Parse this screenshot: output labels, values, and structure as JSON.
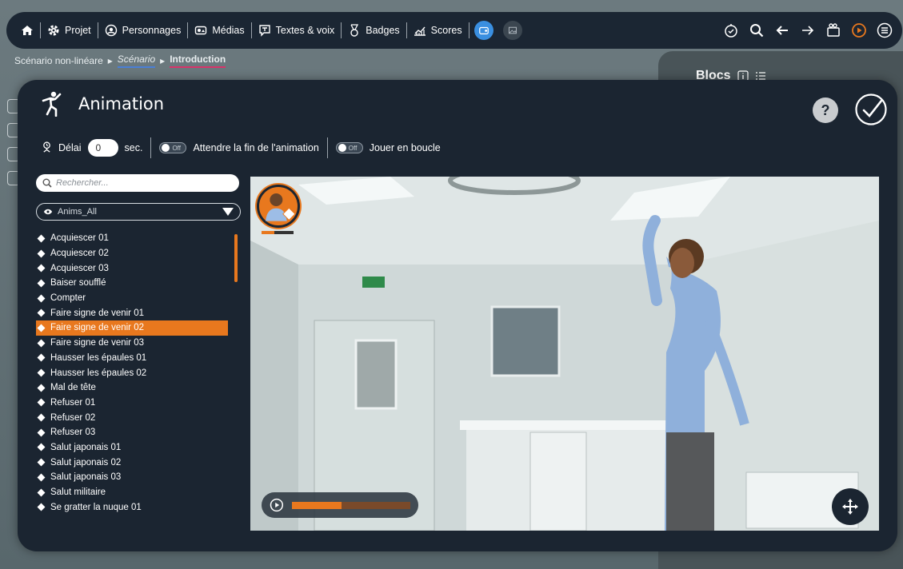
{
  "topbar": {
    "items": [
      {
        "label": "Projet",
        "icon": "gear-icon"
      },
      {
        "label": "Personnages",
        "icon": "character-icon"
      },
      {
        "label": "Médias",
        "icon": "media-icon"
      },
      {
        "label": "Textes & voix",
        "icon": "text-voice-icon"
      },
      {
        "label": "Badges",
        "icon": "badge-icon"
      },
      {
        "label": "Scores",
        "icon": "scores-icon"
      }
    ]
  },
  "breadcrumb": {
    "root": "Scénario non-linéare",
    "scenario": "Scénario",
    "current": "Introduction"
  },
  "right_panel": {
    "title": "Blocs"
  },
  "modal": {
    "title": "Animation",
    "help_label": "?",
    "options": {
      "delay_label": "Délai",
      "delay_value": "0",
      "delay_unit": "sec.",
      "toggle_off": "Off",
      "wait_label": "Attendre la fin de l'animation",
      "loop_label": "Jouer en boucle"
    },
    "search_placeholder": "Rechercher...",
    "filter_value": "Anims_All",
    "animations": [
      "Acquiescer 01",
      "Acquiescer 02",
      "Acquiescer 03",
      "Baiser soufflé",
      "Compter",
      "Faire signe de venir 01",
      "Faire signe de venir 02",
      "Faire signe de venir 03",
      "Hausser les épaules 01",
      "Hausser les épaules 02",
      "Mal de tête",
      "Refuser 01",
      "Refuser 02",
      "Refuser 03",
      "Salut japonais 01",
      "Salut japonais 02",
      "Salut japonais 03",
      "Salut militaire",
      "Se gratter la nuque 01"
    ],
    "selected_index": 6,
    "playback_progress": 0.42,
    "avatar_progress": 0.4
  },
  "colors": {
    "accent": "#e8781e",
    "panel": "#1b2531",
    "highlight_blue": "#4a7fd6",
    "highlight_pink": "#d8336a"
  }
}
